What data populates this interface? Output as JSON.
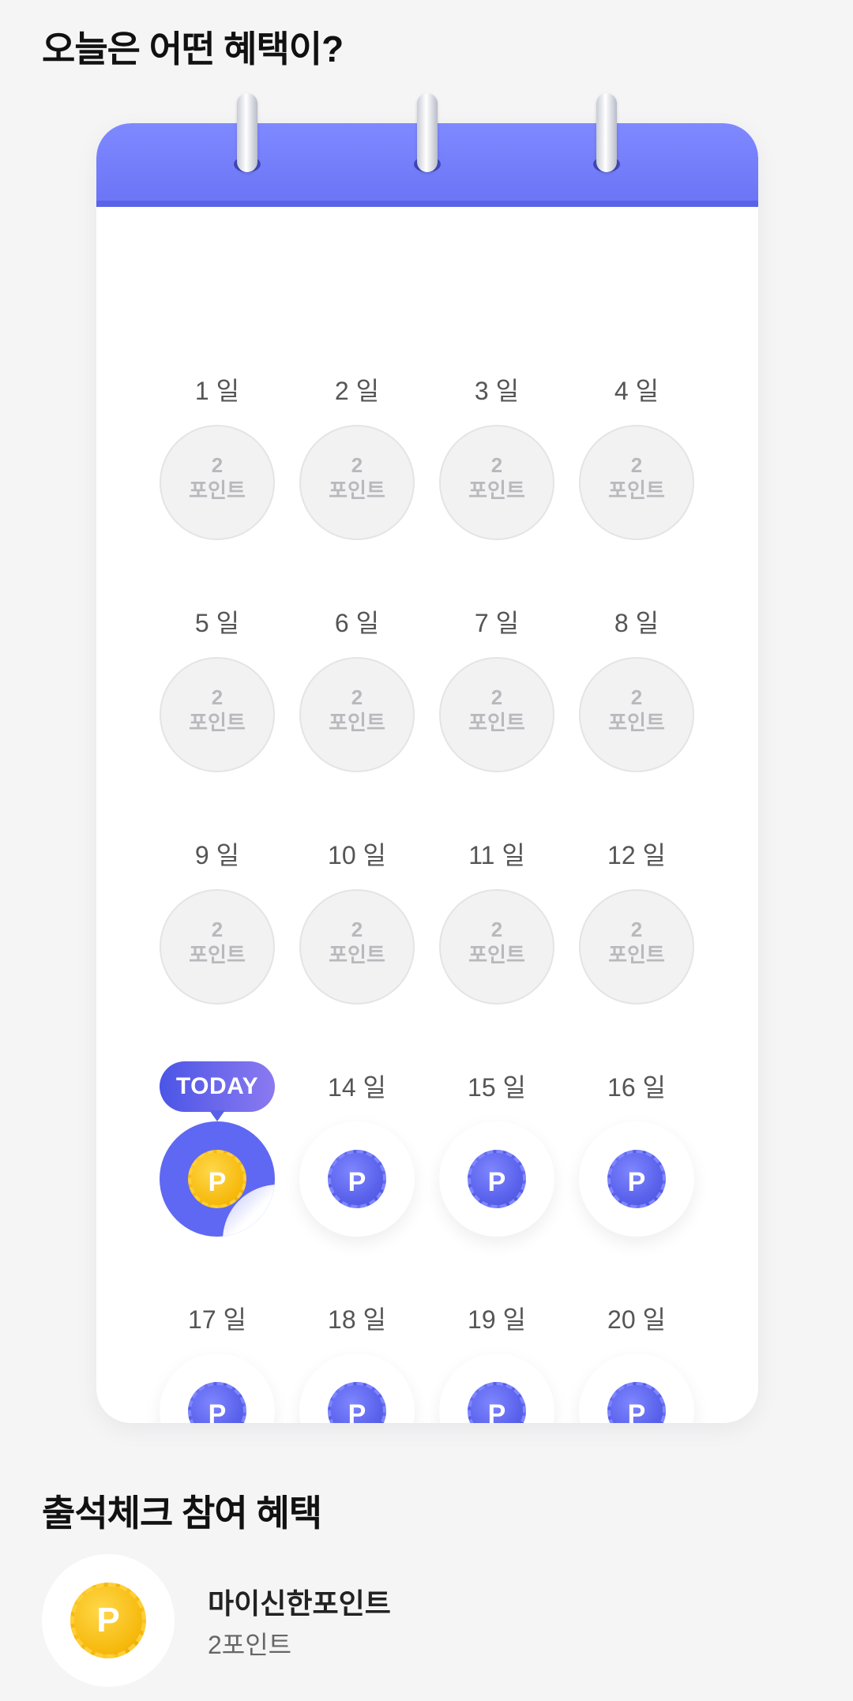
{
  "title_today": "오늘은 어떤 혜택이?",
  "calendar": {
    "days_done": [
      {
        "label": "1 일",
        "points": "2",
        "unit": "포인트"
      },
      {
        "label": "2 일",
        "points": "2",
        "unit": "포인트"
      },
      {
        "label": "3 일",
        "points": "2",
        "unit": "포인트"
      },
      {
        "label": "4 일",
        "points": "2",
        "unit": "포인트"
      },
      {
        "label": "5 일",
        "points": "2",
        "unit": "포인트"
      },
      {
        "label": "6 일",
        "points": "2",
        "unit": "포인트"
      },
      {
        "label": "7 일",
        "points": "2",
        "unit": "포인트"
      },
      {
        "label": "8 일",
        "points": "2",
        "unit": "포인트"
      },
      {
        "label": "9 일",
        "points": "2",
        "unit": "포인트"
      },
      {
        "label": "10 일",
        "points": "2",
        "unit": "포인트"
      },
      {
        "label": "11 일",
        "points": "2",
        "unit": "포인트"
      },
      {
        "label": "12 일",
        "points": "2",
        "unit": "포인트"
      }
    ],
    "today_badge": "TODAY",
    "coin_letter": "P",
    "days_future": [
      {
        "label": "14 일"
      },
      {
        "label": "15 일"
      },
      {
        "label": "16 일"
      },
      {
        "label": "17 일"
      },
      {
        "label": "18 일"
      },
      {
        "label": "19 일"
      },
      {
        "label": "20 일"
      }
    ]
  },
  "title_benefit": "출석체크 참여 혜택",
  "benefit": {
    "name": "마이신한포인트",
    "value": "2포인트",
    "icon": "gold-point-coin-icon"
  },
  "colors": {
    "accent": "#5f68f2",
    "background": "#f5f5f6"
  }
}
